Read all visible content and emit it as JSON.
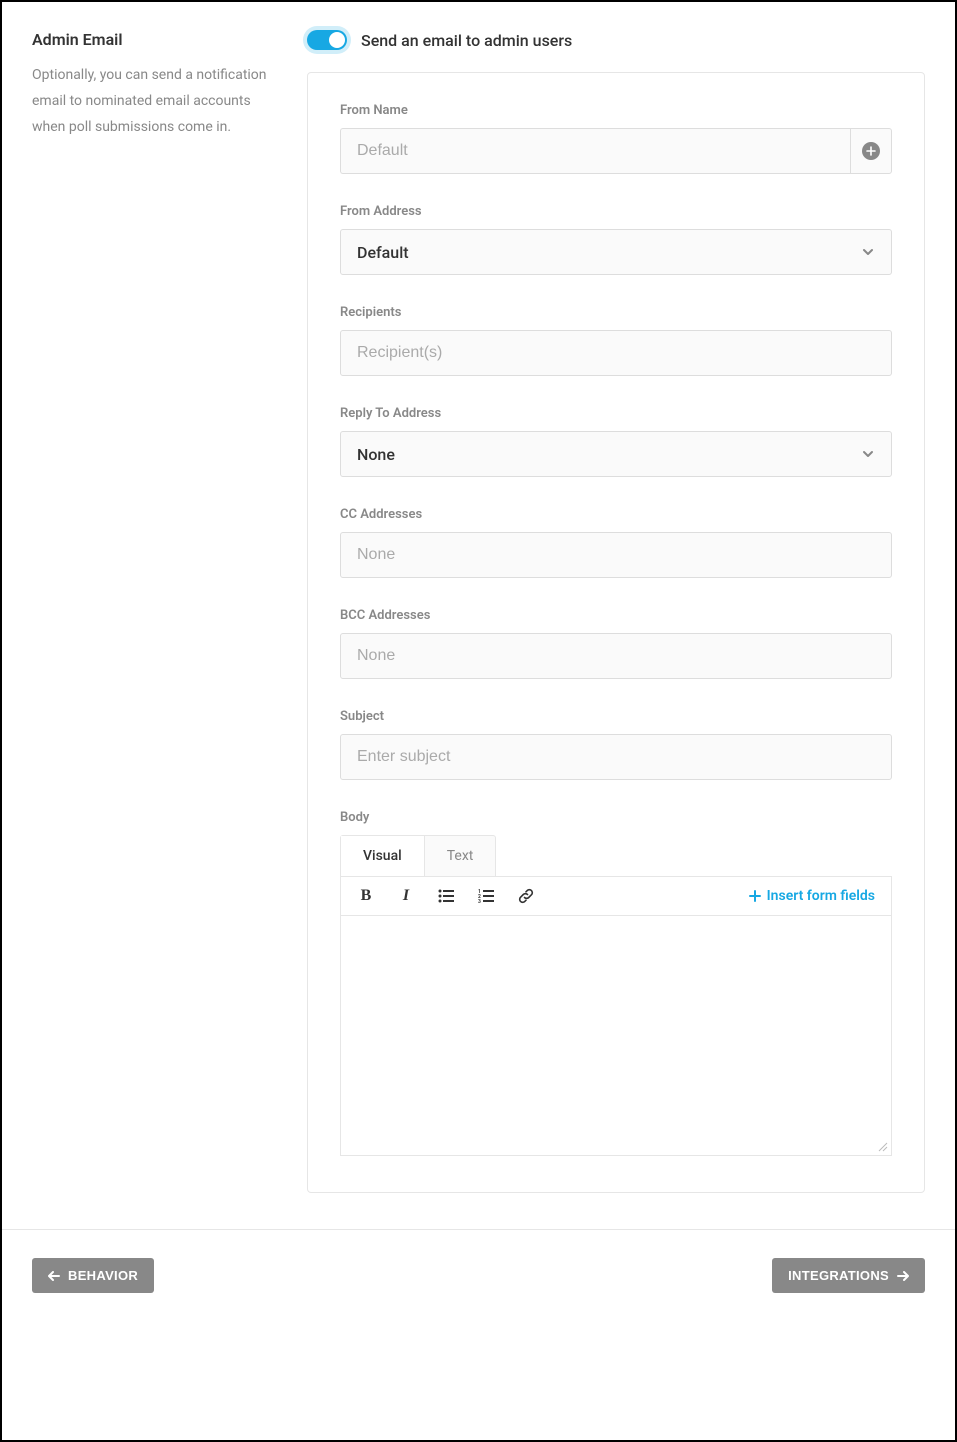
{
  "sidebar": {
    "title": "Admin Email",
    "description": "Optionally, you can send a notification email to nominated email accounts when poll submissions come in."
  },
  "toggle": {
    "label": "Send an email to admin users",
    "enabled": true
  },
  "fields": {
    "from_name": {
      "label": "From Name",
      "placeholder": "Default"
    },
    "from_address": {
      "label": "From Address",
      "value": "Default"
    },
    "recipients": {
      "label": "Recipients",
      "placeholder": "Recipient(s)"
    },
    "reply_to": {
      "label": "Reply To Address",
      "value": "None"
    },
    "cc": {
      "label": "CC Addresses",
      "placeholder": "None"
    },
    "bcc": {
      "label": "BCC Addresses",
      "placeholder": "None"
    },
    "subject": {
      "label": "Subject",
      "placeholder": "Enter subject"
    },
    "body": {
      "label": "Body",
      "tabs": {
        "visual": "Visual",
        "text": "Text"
      },
      "insert_fields": "Insert form fields"
    }
  },
  "footer": {
    "prev": "BEHAVIOR",
    "next": "INTEGRATIONS"
  }
}
